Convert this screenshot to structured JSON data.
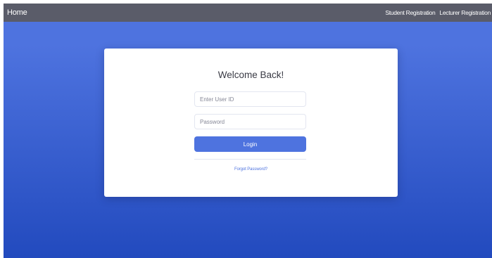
{
  "nav": {
    "brand": "Home",
    "links": [
      "Student Registration",
      "Lecturer Registration"
    ]
  },
  "login": {
    "title": "Welcome Back!",
    "userid_placeholder": "Enter User ID",
    "password_placeholder": "Password",
    "button_label": "Login",
    "forgot_label": "Forgot Password?"
  },
  "colors": {
    "navbar": "#5a5c69",
    "gradient_top": "#4e73df",
    "gradient_bottom": "#224abe",
    "button": "#4e73df"
  }
}
